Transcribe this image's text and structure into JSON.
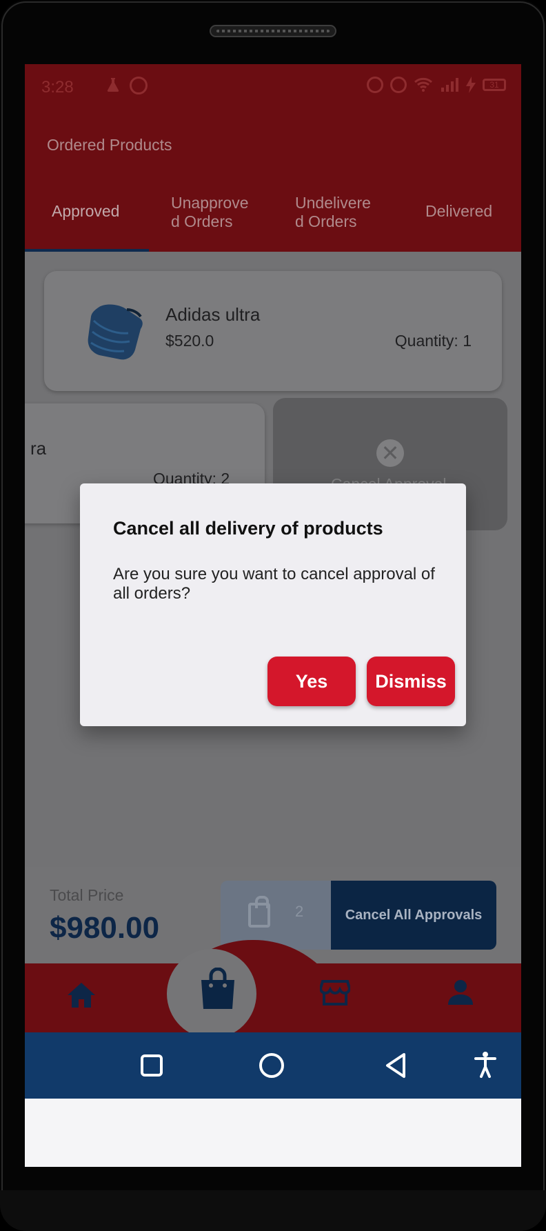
{
  "status_bar": {
    "time": "3:28",
    "battery": "31"
  },
  "header": {
    "title": "Ordered Products"
  },
  "tabs": [
    {
      "label": "Approved"
    },
    {
      "label": "Unapprove d Orders"
    },
    {
      "label": "Undelivere d Orders"
    },
    {
      "label": "Delivered"
    }
  ],
  "orders": [
    {
      "name": "Adidas ultra",
      "price": "$520.0",
      "quantity": "Quantity: 1"
    },
    {
      "name": "ra",
      "quantity": "Quantity: 2"
    }
  ],
  "swipe_action": {
    "label": "Cancel Approval"
  },
  "summary": {
    "total_label": "Total Price",
    "total_value": "$980.00",
    "cart_count": "2",
    "cancel_all_label": "Cancel All Approvals"
  },
  "dialog": {
    "title": "Cancel all delivery of products",
    "body": "Are you sure you want to cancel approval of all orders?",
    "yes_label": "Yes",
    "dismiss_label": "Dismiss"
  },
  "colors": {
    "brand_red": "#d4172b",
    "brand_navy": "#0d2647",
    "system_nav": "#113a6a"
  },
  "icons": {
    "bottom_nav": [
      "home-icon",
      "shopping-bag-icon",
      "store-icon",
      "person-icon"
    ],
    "system_nav": [
      "recent-apps-icon",
      "home-circle-icon",
      "back-icon",
      "accessibility-icon"
    ]
  }
}
